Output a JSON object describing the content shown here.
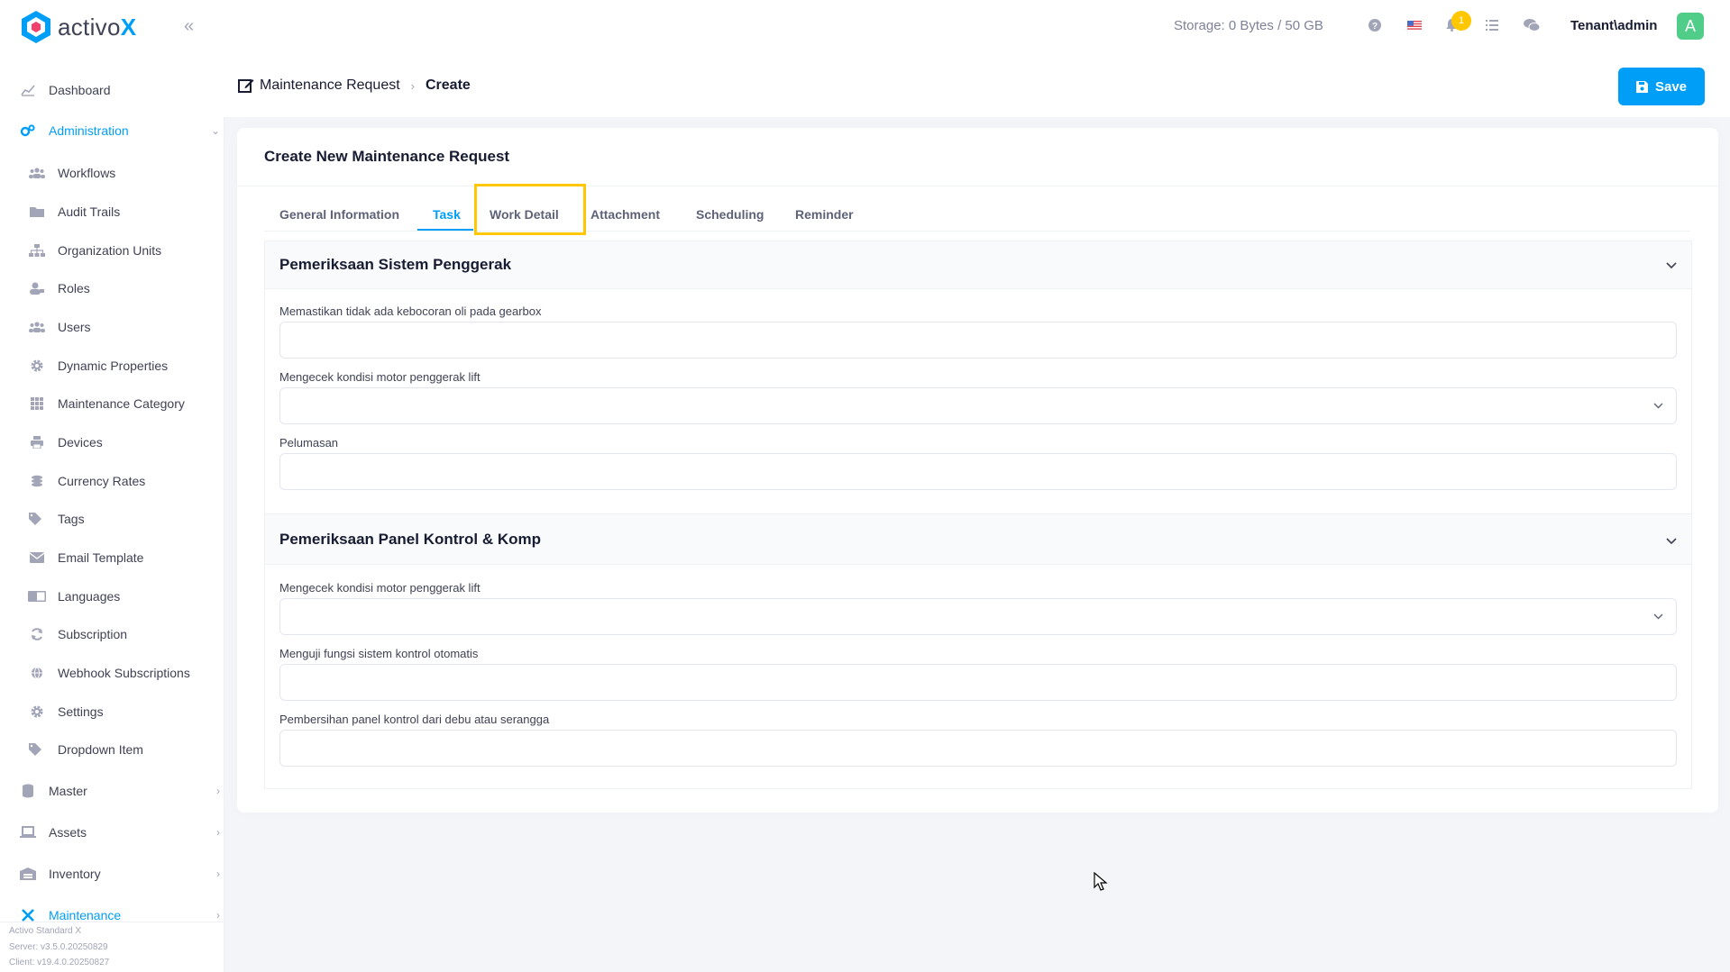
{
  "app": {
    "brand_prefix": "activo",
    "brand_suffix": "X"
  },
  "sidebar": {
    "items": [
      {
        "label": "Dashboard",
        "icon": "chart-line-icon"
      },
      {
        "label": "Administration",
        "icon": "cogs-icon"
      },
      {
        "label": "Workflows",
        "icon": "users-icon"
      },
      {
        "label": "Audit Trails",
        "icon": "folder-icon"
      },
      {
        "label": "Organization Units",
        "icon": "sitemap-icon"
      },
      {
        "label": "Roles",
        "icon": "user-tag-icon"
      },
      {
        "label": "Users",
        "icon": "users-icon"
      },
      {
        "label": "Dynamic Properties",
        "icon": "gear-icon"
      },
      {
        "label": "Maintenance Category",
        "icon": "grid-icon"
      },
      {
        "label": "Devices",
        "icon": "printer-icon"
      },
      {
        "label": "Currency Rates",
        "icon": "coins-icon"
      },
      {
        "label": "Tags",
        "icon": "tags-icon"
      },
      {
        "label": "Email Template",
        "icon": "envelope-icon"
      },
      {
        "label": "Languages",
        "icon": "language-icon"
      },
      {
        "label": "Subscription",
        "icon": "sync-icon"
      },
      {
        "label": "Webhook Subscriptions",
        "icon": "globe-icon"
      },
      {
        "label": "Settings",
        "icon": "gear-icon"
      },
      {
        "label": "Dropdown Item",
        "icon": "tags-icon"
      },
      {
        "label": "Master",
        "icon": "database-icon"
      },
      {
        "label": "Assets",
        "icon": "laptop-icon"
      },
      {
        "label": "Inventory",
        "icon": "warehouse-icon"
      },
      {
        "label": "Maintenance",
        "icon": "tools-icon"
      }
    ],
    "footer": {
      "edition": "Activo Standard X",
      "server": "Server: v3.5.0.20250829",
      "client": "Client: v19.4.0.20250827"
    }
  },
  "topbar": {
    "storage": "Storage: 0 Bytes / 50 GB",
    "notification_count": "1",
    "user": "Tenant\\admin",
    "avatar_letter": "A"
  },
  "toolbar": {
    "breadcrumb_parent": "Maintenance Request",
    "breadcrumb_current": "Create",
    "save_label": "Save"
  },
  "form": {
    "title": "Create New Maintenance Request",
    "tabs": [
      "General Information",
      "Task",
      "Work Detail",
      "Attachment",
      "Scheduling",
      "Reminder"
    ],
    "active_tab": "Task",
    "panels": [
      {
        "title": "Pemeriksaan Sistem Penggerak",
        "fields": [
          {
            "label": "Memastikan tidak ada kebocoran oli pada gearbox",
            "type": "text",
            "value": ""
          },
          {
            "label": "Mengecek kondisi motor penggerak lift",
            "type": "select",
            "value": ""
          },
          {
            "label": "Pelumasan",
            "type": "text",
            "value": ""
          }
        ]
      },
      {
        "title": "Pemeriksaan Panel Kontrol & Komp",
        "fields": [
          {
            "label": "Mengecek kondisi motor penggerak lift",
            "type": "select",
            "value": ""
          },
          {
            "label": "Menguji fungsi sistem kontrol otomatis",
            "type": "text",
            "value": ""
          },
          {
            "label": "Pembersihan panel kontrol dari debu atau serangga",
            "type": "text",
            "value": ""
          }
        ]
      }
    ]
  },
  "colors": {
    "accent": "#009ef7",
    "highlight": "#ffc700",
    "avatar": "#50cd89"
  }
}
